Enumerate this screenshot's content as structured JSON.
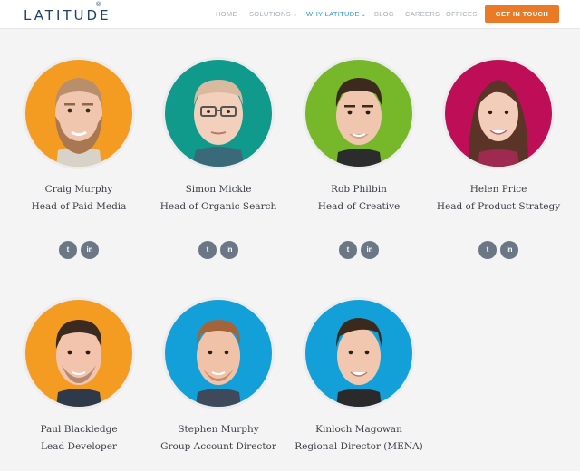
{
  "header": {
    "logo": "LATITUDE",
    "logo_mark": "®",
    "nav": [
      {
        "label": "HOME"
      },
      {
        "label": "SOLUTIONS"
      },
      {
        "label": "WHY LATITUDE"
      },
      {
        "label": "BLOG"
      },
      {
        "label": "CAREERS"
      },
      {
        "label": "OFFICES"
      }
    ],
    "cta": "GET IN TOUCH"
  },
  "colors": {
    "brand": "#21416a",
    "nav_active": "#2a93d0",
    "cta": "#ea7a25",
    "orange": "#f49c22",
    "teal": "#0f9a8b",
    "green": "#76b82a",
    "magenta": "#bd0e57",
    "blue": "#13a0d9"
  },
  "team": [
    {
      "name": "Craig Murphy",
      "role": "Head of Paid Media",
      "avatar_color": "#f49c22",
      "socials": [
        "twitter-icon",
        "linkedin-icon"
      ]
    },
    {
      "name": "Simon Mickle",
      "role": "Head of Organic Search",
      "avatar_color": "#0f9a8b",
      "socials": [
        "twitter-icon",
        "linkedin-icon"
      ]
    },
    {
      "name": "Rob Philbin",
      "role": "Head of Creative",
      "avatar_color": "#76b82a",
      "socials": [
        "twitter-icon",
        "linkedin-icon"
      ]
    },
    {
      "name": "Helen Price",
      "role": "Head of Product Strategy",
      "avatar_color": "#bd0e57",
      "socials": [
        "twitter-icon",
        "linkedin-icon"
      ]
    },
    {
      "name": "Paul Blackledge",
      "role": "Lead Developer",
      "avatar_color": "#f49c22"
    },
    {
      "name": "Stephen Murphy",
      "role": "Group Account Director",
      "avatar_color": "#13a0d9"
    },
    {
      "name": "Kinloch Magowan",
      "role": "Regional Director (MENA)",
      "avatar_color": "#13a0d9"
    }
  ],
  "social_glyphs": {
    "twitter": "t",
    "linkedin": "in"
  }
}
